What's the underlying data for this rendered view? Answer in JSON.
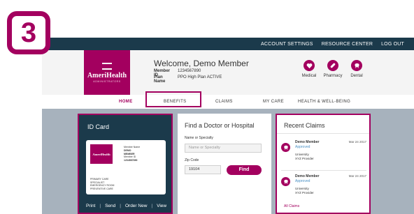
{
  "step": {
    "number": "3"
  },
  "topbar": {
    "links": [
      "ACCOUNT SETTINGS",
      "RESOURCE CENTER",
      "LOG OUT"
    ]
  },
  "logo": {
    "name": "AmeriHealth",
    "tagline": "ADMINISTRATORS"
  },
  "header": {
    "welcome": "Welcome, Demo Member",
    "member_id_label": "Member ID",
    "member_id": "1234567890",
    "plan_name_label": "Plan Name",
    "plan_name": "PPO High Plan ACTIVE"
  },
  "quick_links": [
    {
      "label": "Medical",
      "icon": "medical-icon"
    },
    {
      "label": "Pharmacy",
      "icon": "pill-icon"
    },
    {
      "label": "Dental",
      "icon": "tooth-icon"
    }
  ],
  "nav": {
    "items": [
      "HOME",
      "BENEFITS",
      "CLAIMS",
      "MY CARE",
      "HEALTH & WELL-BEING"
    ],
    "active": "HOME"
  },
  "id_card": {
    "title": "ID Card",
    "card_logo": "AmeriHealth",
    "fields_1": [
      "Member Name",
      "DEMO",
      "MEMBER"
    ],
    "fields_2": [
      "Member ID",
      "1234567890"
    ],
    "fields_3": [
      "PRIMARY CARE",
      "SPECIALIST",
      "EMERGENCY ROOM",
      "PREVENTIVE CARE"
    ],
    "actions": [
      "Print",
      "Send",
      "Order New",
      "View"
    ]
  },
  "find_doctor": {
    "title": "Find a Doctor or Hospital",
    "name_label": "Name or Specialty",
    "name_placeholder": "Name or Specialty",
    "zip_label": "Zip Code",
    "zip_value": "19104",
    "button": "Find"
  },
  "recent_claims": {
    "title": "Recent Claims",
    "claims": [
      {
        "member": "Demo Member",
        "status": "Approved",
        "date": "Mar 24 2017",
        "provider_line1": "University",
        "provider_line2": "XYZ Provider"
      },
      {
        "member": "Demo Member",
        "status": "Approved",
        "date": "Mar 24 2017",
        "provider_line1": "University",
        "provider_line2": "XYZ Provider"
      }
    ],
    "all_link": "All Claims"
  },
  "colors": {
    "brand": "#a3005f",
    "navy": "#1b3a4b",
    "content_bg": "#a7b2bd",
    "link_blue": "#4a90c4"
  }
}
